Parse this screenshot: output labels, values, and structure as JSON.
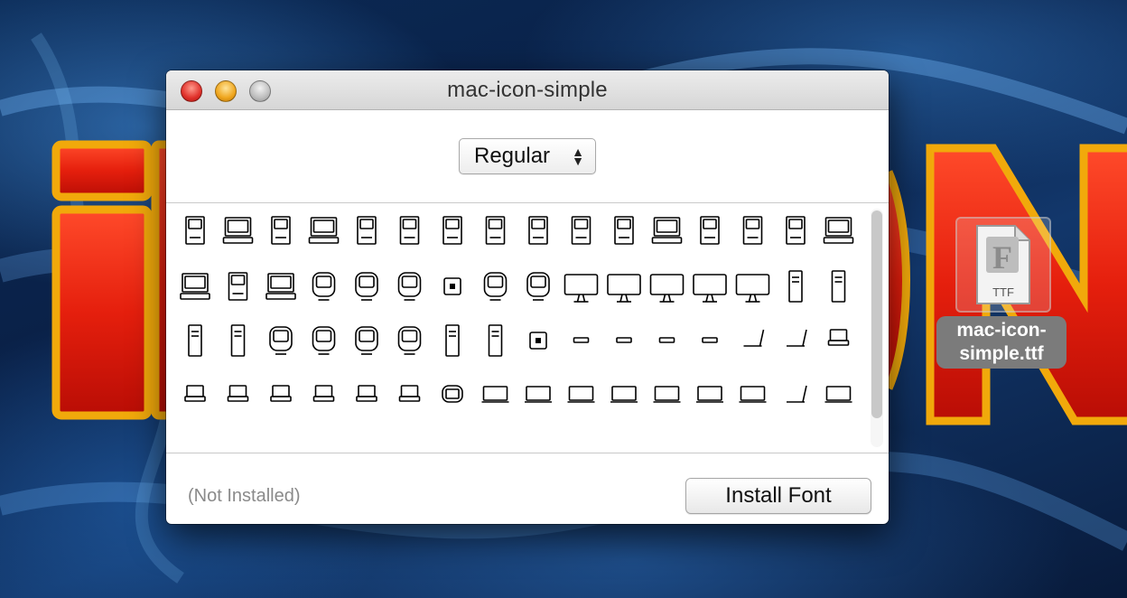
{
  "window": {
    "title": "mac-icon-simple",
    "style_selected": "Regular",
    "status": "(Not Installed)",
    "install_label": "Install Font"
  },
  "desktop": {
    "file_name": "mac-icon-simple.ttf",
    "file_type": "TTF",
    "file_glyph": "F"
  },
  "icons": {
    "close": "close-icon",
    "minimize": "minimize-icon",
    "zoom": "zoom-icon",
    "popup": "up-down-chevron-icon",
    "file": "ttf-font-file-icon"
  },
  "colors": {
    "close": "#e0302a",
    "minimize": "#efa51c",
    "zoom": "#bdbdbd",
    "label_bg": "#7b7b7b"
  },
  "glyph_rows": [
    [
      "classic-mac",
      "mac-with-keyboard",
      "classic-mac",
      "mac-ii",
      "classic-mac",
      "mac-se",
      "mac-color-classic",
      "classic-mac",
      "mac-lc",
      "classic-mac",
      "classic-mac",
      "mac-performa",
      "classic-mac",
      "classic-mac",
      "classic-mac",
      "mac-centris"
    ],
    [
      "mac-quadra",
      "powermac",
      "twentieth-anniversary-mac",
      "imac-g3",
      "emac",
      "imac-dv",
      "cube",
      "imac-wide",
      "imac-g4",
      "imac-g5",
      "imac",
      "cinema-display",
      "cinema-display-wide",
      "cinema-display-wide",
      "tower-slim",
      "tower"
    ],
    [
      "tower-beige",
      "tower-g3",
      "tower-g4",
      "tower-g4-mdd",
      "tower-g4-qs",
      "tower-g5",
      "mac-pro",
      "mac-pro",
      "mac-mini",
      "xserve",
      "xserve",
      "xserve",
      "xserve",
      "powerbook-open",
      "powerbook-side",
      "powerbook-100"
    ],
    [
      "powerbook",
      "powerbook",
      "powerbook",
      "powerbook",
      "powerbook",
      "powerbook",
      "ibook-clamshell",
      "powerbook-g4",
      "ibook",
      "ibook",
      "macbook",
      "macbook-pro",
      "macbook-pro",
      "macbook-pro",
      "macbook-air-side",
      "macbook-air"
    ]
  ]
}
